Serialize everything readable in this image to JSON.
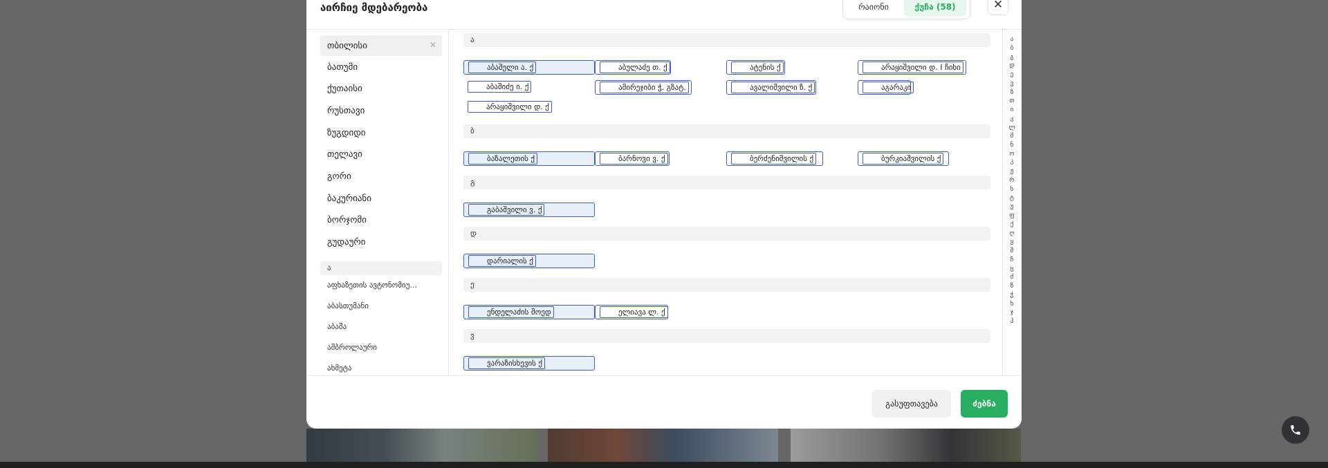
{
  "modal": {
    "title": "აირჩიე მდებარეობა",
    "tabs": {
      "district": "რაიონი",
      "street": "ქუჩა (58)"
    },
    "close_icon": "close-icon"
  },
  "cities": [
    "თბილისი",
    "ბათუმი",
    "ქუთაისი",
    "რუსთავი",
    "ზუგდიდი",
    "თელავი",
    "გორი",
    "ბაკურიანი",
    "ბორჯომი",
    "გუდაური"
  ],
  "region_letter": "ა",
  "regions": [
    "აფხაზეთის ავტონომიუ...",
    "აბასთუმანი",
    "აბაშა",
    "ამბროლაური",
    "ახმეტა"
  ],
  "sections": [
    {
      "letter": "ა",
      "streets": [
        "აბაშელი ა. ქ",
        "აბულაძე თ. ქ",
        "ატენის ქ",
        "არაყიშვილი დ. I ჩიხი",
        "აბაშიძე ი. ქ",
        "ამირეჯიბი ჭ. გზატ.",
        "ავალიშვილი ზ. ქ",
        "აგარაკი",
        "არაყიშვილი დ. ქ"
      ]
    },
    {
      "letter": "ბ",
      "streets": [
        "ბაზალეთის ქ",
        "ბარნოვი ვ. ქ",
        "ბერძენიშვილის ქ",
        "ბურკიაშვილის ქ"
      ]
    },
    {
      "letter": "გ",
      "streets": [
        "გაბაშვილი ვ. ქ"
      ]
    },
    {
      "letter": "დ",
      "streets": [
        "დარიალის ქ"
      ]
    },
    {
      "letter": "ე",
      "streets": [
        "ენდელაძის მოედ",
        "ელიავა ლ. ქ"
      ]
    },
    {
      "letter": "ვ",
      "streets": [
        "ვარაზისხევის ქ"
      ]
    }
  ],
  "alphabet": [
    "ა",
    "ბ",
    "გ",
    "დ",
    "ე",
    "ვ",
    "ზ",
    "თ",
    "ი",
    "კ",
    "ლ",
    "მ",
    "ნ",
    "ო",
    "პ",
    "ჟ",
    "რ",
    "ს",
    "ტ",
    "უ",
    "ფ",
    "ქ",
    "ღ",
    "ყ",
    "შ",
    "ჩ",
    "ც",
    "ძ",
    "წ",
    "ჭ",
    "ხ",
    "ჯ",
    "ჰ"
  ],
  "footer": {
    "clear": "გასუფთავება",
    "search": "ძებნა"
  },
  "fab": {
    "icon": "phone-icon"
  },
  "colors": {
    "accent": "#27ae60",
    "selection": "#3b5bdb"
  }
}
